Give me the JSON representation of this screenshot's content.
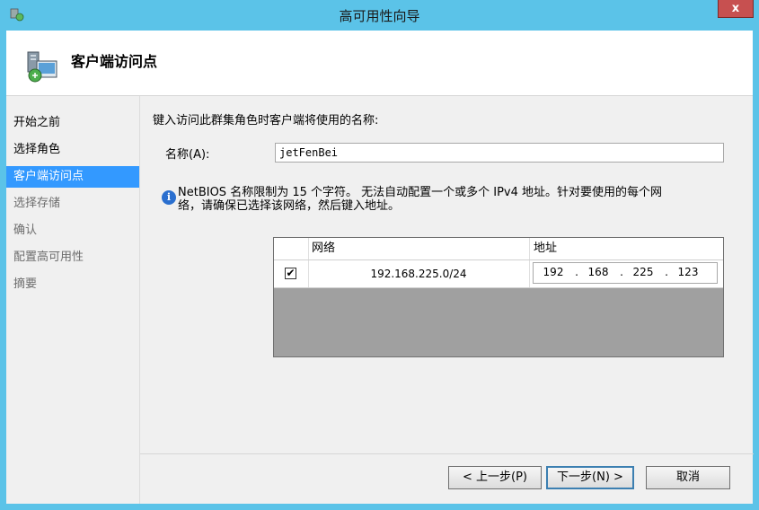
{
  "window": {
    "title": "高可用性向导",
    "close_label": "x"
  },
  "header": {
    "title": "客户端访问点"
  },
  "sidebar": {
    "items": [
      {
        "label": "开始之前",
        "state": "done"
      },
      {
        "label": "选择角色",
        "state": "done"
      },
      {
        "label": "客户端访问点",
        "state": "active"
      },
      {
        "label": "选择存储",
        "state": "pending"
      },
      {
        "label": "确认",
        "state": "pending"
      },
      {
        "label": "配置高可用性",
        "state": "pending"
      },
      {
        "label": "摘要",
        "state": "pending"
      }
    ]
  },
  "main": {
    "prompt": "键入访问此群集角色时客户端将使用的名称:",
    "name_label": "名称(A):",
    "name_value": "jetFenBei",
    "info_line1": "NetBIOS 名称限制为 15 个字符。 无法自动配置一个或多个 IPv4 地址。针对要使用的每个网",
    "info_line2": "络，请确保已选择该网络，然后键入地址。",
    "grid": {
      "col_network": "网络",
      "col_address": "地址",
      "rows": [
        {
          "checked": true,
          "network": "192.168.225.0/24",
          "octets": [
            "192",
            "168",
            "225",
            "123"
          ]
        }
      ]
    }
  },
  "footer": {
    "back_label": "< 上一步(P)",
    "next_label": "下一步(N) >",
    "cancel_label": "取消"
  },
  "colors": {
    "titlebar": "#5bc3e8",
    "selection": "#3399ff",
    "close": "#c75050"
  }
}
